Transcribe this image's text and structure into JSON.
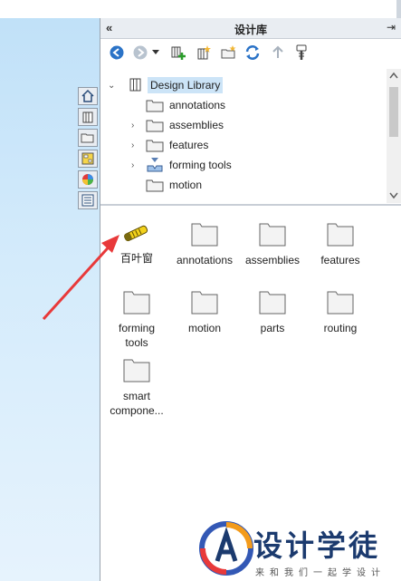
{
  "panel": {
    "title": "设计库",
    "collapse_glyph": "«",
    "pin_glyph": "⇥"
  },
  "toolbar": {
    "buttons": [
      "back-icon",
      "forward-icon",
      "dropdown-icon",
      "add-to-library-icon",
      "add-file-location-icon",
      "create-new-folder-icon",
      "refresh-icon",
      "up-one-level-icon",
      "toolbox-icon"
    ]
  },
  "tree": {
    "root": "Design Library",
    "items": [
      "annotations",
      "assemblies",
      "features",
      "forming tools",
      "motion"
    ]
  },
  "grid": {
    "items": [
      {
        "label": "百叶窗",
        "icon": "louver-icon"
      },
      {
        "label": "annotations",
        "icon": "folder-icon"
      },
      {
        "label": "assemblies",
        "icon": "folder-icon"
      },
      {
        "label": "features",
        "icon": "folder-icon"
      },
      {
        "label": "forming tools",
        "icon": "folder-icon"
      },
      {
        "label": "motion",
        "icon": "folder-icon"
      },
      {
        "label": "parts",
        "icon": "folder-icon"
      },
      {
        "label": "routing",
        "icon": "folder-icon"
      },
      {
        "label": "smart compone...",
        "icon": "folder-icon"
      }
    ]
  },
  "side_tabs": [
    "home-icon",
    "design-library-icon",
    "file-explorer-icon",
    "view-palette-icon",
    "appearances-icon",
    "custom-properties-icon"
  ],
  "watermark": {
    "title": "设计学徒",
    "subtitle": "来和我们一起学设计"
  },
  "colors": {
    "accent_red": "#e8393a",
    "folder_fill": "#f3f3f3",
    "selected_bg": "#cce4f7"
  }
}
